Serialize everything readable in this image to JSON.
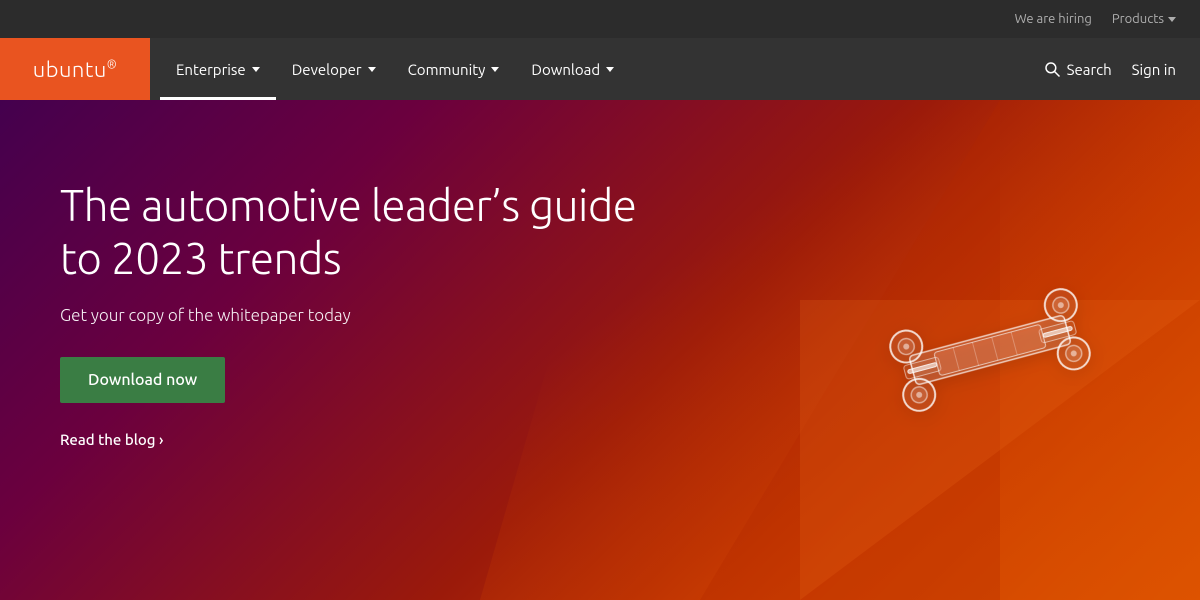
{
  "topbar": {
    "we_are_hiring": "We are hiring",
    "products": "Products",
    "products_chevron": "chevron-down"
  },
  "nav": {
    "logo": "ubuntu",
    "logo_reg": "®",
    "items": [
      {
        "label": "Enterprise",
        "has_dropdown": true,
        "active": true
      },
      {
        "label": "Developer",
        "has_dropdown": true
      },
      {
        "label": "Community",
        "has_dropdown": true
      },
      {
        "label": "Download",
        "has_dropdown": true
      }
    ],
    "search_label": "Search",
    "signin_label": "Sign in"
  },
  "hero": {
    "heading_line1": "The automotive leader’s guide",
    "heading_line2": "to 2023 trends",
    "subtext": "Get your copy of the whitepaper today",
    "cta_button": "Download now",
    "blog_link": "Read the blog ›"
  }
}
